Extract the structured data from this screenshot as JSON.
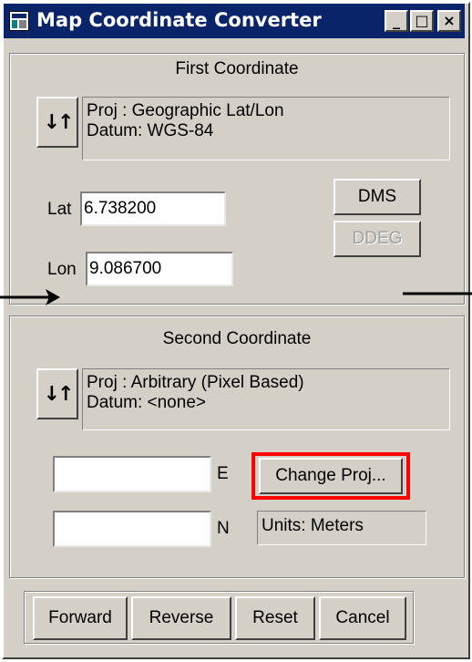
{
  "window": {
    "title": "Map Coordinate Converter",
    "controls": {
      "minimize": "_",
      "maximize": "□",
      "close": "×"
    }
  },
  "first_coordinate": {
    "title": "First Coordinate",
    "swap_icon": "swap-arrows-icon",
    "swap_glyph": "↓↑",
    "projection": "Proj : Geographic Lat/Lon",
    "datum": "Datum: WGS-84",
    "lat_label": "Lat",
    "lat_value": "6.738200",
    "lon_label": "Lon",
    "lon_value": "9.086700",
    "dms_label": "DMS",
    "ddeg_label": "DDEG"
  },
  "second_coordinate": {
    "title": "Second Coordinate",
    "swap_icon": "swap-arrows-icon",
    "swap_glyph": "↓↑",
    "projection": "Proj : Arbitrary (Pixel Based)",
    "datum": "Datum: <none>",
    "e_label": "E",
    "e_value": "",
    "n_label": "N",
    "n_value": "",
    "change_proj_label": "Change Proj...",
    "units": "Units: Meters"
  },
  "actions": {
    "forward": "Forward",
    "reverse": "Reverse",
    "reset": "Reset",
    "cancel": "Cancel"
  },
  "colors": {
    "face": "#d4d0c8",
    "title_bar": "#0a246a",
    "highlight": "#ff0000"
  }
}
